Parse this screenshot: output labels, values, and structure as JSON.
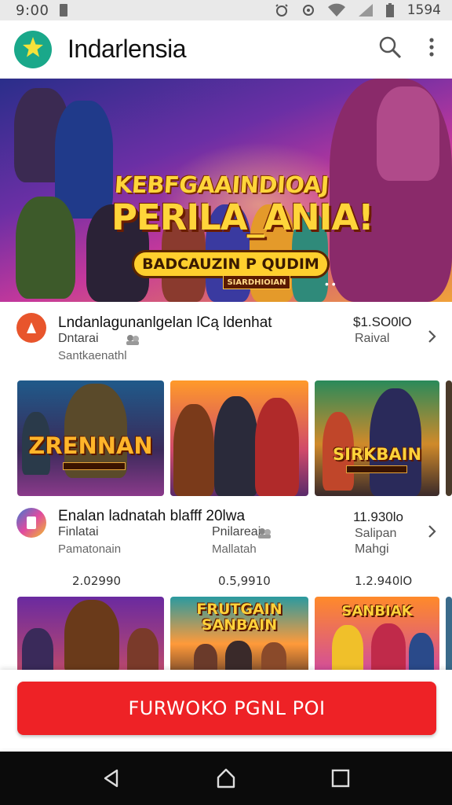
{
  "status_bar": {
    "time": "9:00",
    "clock": "1594",
    "icons": [
      "notification-icon",
      "alarm-icon",
      "settings-icon",
      "wifi-icon",
      "signal-icon",
      "battery-icon"
    ]
  },
  "app_bar": {
    "title": "Indarlensia",
    "logo_icon": "star-icon",
    "actions": [
      "search-icon",
      "more-vert-icon"
    ]
  },
  "hero": {
    "title_line1": "KEBFGAAINDIOAJ",
    "title_line2": "PERILA_ANIA!",
    "subtitle": "BADCAUZIN P QUDIM",
    "badge": "SIARDHIOIAN",
    "dots": "• •"
  },
  "rows": [
    {
      "title": "Lndanlagunanlgelan lCą ldenhat",
      "sub": "Dntarai",
      "meta": "Santkaenathl",
      "price": "$1.SO0lO",
      "price_sub": "Raival",
      "icon_color": "#e8552c"
    },
    {
      "title": "Enalan ladnatah blafff 20lwa",
      "sub": "Finlatai",
      "meta": "Pamatonain",
      "sub2": "Pnilareai",
      "meta2": "Mallatah",
      "price": "11.930lo",
      "price_sub": "Salipan",
      "price_sub2": "Mahgi",
      "icon_color": "#7a3fd0"
    }
  ],
  "tiles_row1": [
    {
      "label": "ZRENNAN",
      "sublabel": ""
    },
    {
      "label": "",
      "sublabel": ""
    },
    {
      "label": "SIRKBAIN",
      "sublabel": ""
    }
  ],
  "mid_stats": [
    "2.02990",
    "0.5,9910",
    "1.2.940lO"
  ],
  "tiles_row2": [
    {
      "label": ""
    },
    {
      "label": "FRUTGAIN SANBAIN"
    },
    {
      "label": "SANBIAK"
    }
  ],
  "cta": {
    "label": "FURWOKO PGNL POI"
  },
  "nav_bar": [
    "back-icon",
    "home-icon",
    "recents-icon"
  ],
  "colors": {
    "accent_red": "#ee2226",
    "logo_teal": "#1aa88a",
    "hero_gold": "#ffd53a"
  }
}
